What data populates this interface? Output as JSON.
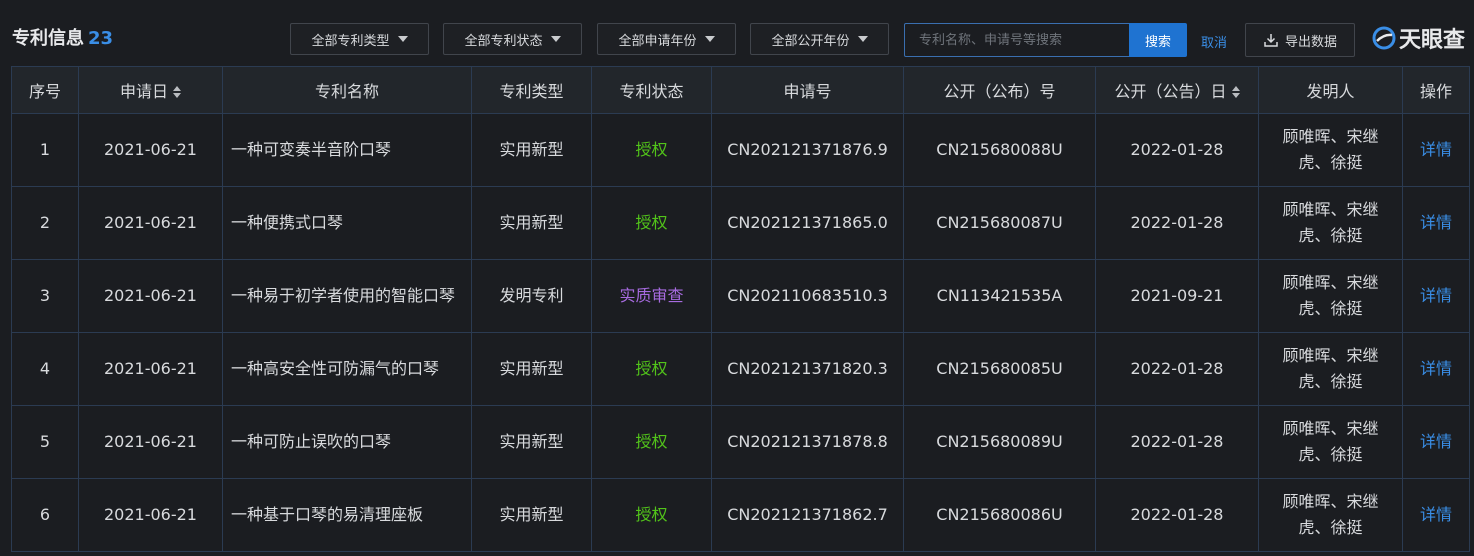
{
  "header": {
    "title": "专利信息",
    "count": "23"
  },
  "filters": [
    {
      "label": "全部专利类型"
    },
    {
      "label": "全部专利状态"
    },
    {
      "label": "全部申请年份"
    },
    {
      "label": "全部公开年份"
    }
  ],
  "search": {
    "placeholder": "专利名称、申请号等搜索",
    "value": "",
    "button": "搜索",
    "cancel": "取消"
  },
  "export": {
    "label": "导出数据",
    "icon": "download-icon"
  },
  "logo": {
    "text": "天眼查",
    "icon": "tianyancha-logo-icon"
  },
  "colors": {
    "accent": "#3a8ee6",
    "search_button": "#1f73d1",
    "granted": "#52c41a",
    "review": "#a76be0",
    "background": "#1b1d21"
  },
  "table": {
    "columns": [
      "序号",
      "申请日",
      "专利名称",
      "专利类型",
      "专利状态",
      "申请号",
      "公开（公布）号",
      "公开（公告）日",
      "发明人",
      "操作"
    ],
    "rows": [
      {
        "no": "1",
        "date": "2021-06-21",
        "name": "一种可变奏半音阶口琴",
        "type": "实用新型",
        "status": "授权",
        "status_kind": "granted",
        "app_no": "CN202121371876.9",
        "pub_no": "CN215680088U",
        "pub_date": "2022-01-28",
        "inventors": "顾唯晖、宋继虎、徐挺",
        "action": "详情"
      },
      {
        "no": "2",
        "date": "2021-06-21",
        "name": "一种便携式口琴",
        "type": "实用新型",
        "status": "授权",
        "status_kind": "granted",
        "app_no": "CN202121371865.0",
        "pub_no": "CN215680087U",
        "pub_date": "2022-01-28",
        "inventors": "顾唯晖、宋继虎、徐挺",
        "action": "详情"
      },
      {
        "no": "3",
        "date": "2021-06-21",
        "name": "一种易于初学者使用的智能口琴",
        "type": "发明专利",
        "status": "实质审查",
        "status_kind": "review",
        "app_no": "CN202110683510.3",
        "pub_no": "CN113421535A",
        "pub_date": "2021-09-21",
        "inventors": "顾唯晖、宋继虎、徐挺",
        "action": "详情"
      },
      {
        "no": "4",
        "date": "2021-06-21",
        "name": "一种高安全性可防漏气的口琴",
        "type": "实用新型",
        "status": "授权",
        "status_kind": "granted",
        "app_no": "CN202121371820.3",
        "pub_no": "CN215680085U",
        "pub_date": "2022-01-28",
        "inventors": "顾唯晖、宋继虎、徐挺",
        "action": "详情"
      },
      {
        "no": "5",
        "date": "2021-06-21",
        "name": "一种可防止误吹的口琴",
        "type": "实用新型",
        "status": "授权",
        "status_kind": "granted",
        "app_no": "CN202121371878.8",
        "pub_no": "CN215680089U",
        "pub_date": "2022-01-28",
        "inventors": "顾唯晖、宋继虎、徐挺",
        "action": "详情"
      },
      {
        "no": "6",
        "date": "2021-06-21",
        "name": "一种基于口琴的易清理座板",
        "type": "实用新型",
        "status": "授权",
        "status_kind": "granted",
        "app_no": "CN202121371862.7",
        "pub_no": "CN215680086U",
        "pub_date": "2022-01-28",
        "inventors": "顾唯晖、宋继虎、徐挺",
        "action": "详情"
      }
    ]
  }
}
